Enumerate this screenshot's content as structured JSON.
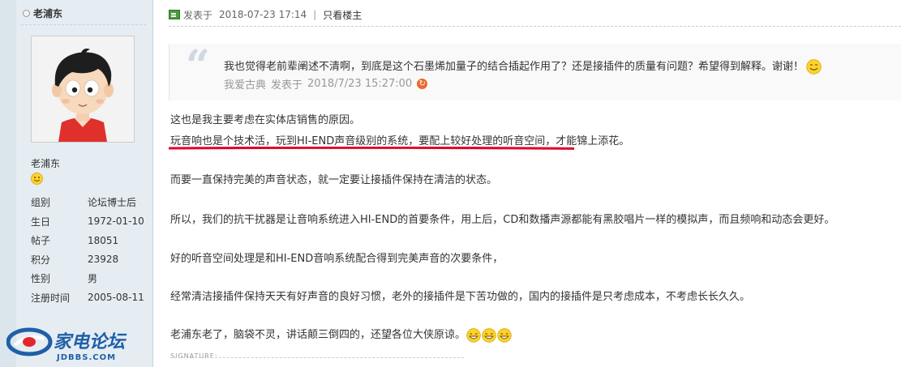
{
  "sidebar": {
    "author": "老浦东",
    "username": "老浦东",
    "info": [
      {
        "key": "组别",
        "value": "论坛博士后"
      },
      {
        "key": "生日",
        "value": "1972-01-10"
      },
      {
        "key": "帖子",
        "value": "18051"
      },
      {
        "key": "积分",
        "value": "23928"
      },
      {
        "key": "性别",
        "value": "男"
      },
      {
        "key": "注册时间",
        "value": "2005-08-11"
      }
    ],
    "logo_text": "家电论坛",
    "logo_url": "JDBBS.COM"
  },
  "post": {
    "posted_label": "发表于",
    "posted_time": "2018-07-23 17:14",
    "separator": "|",
    "author_only": "只看楼主",
    "quote": {
      "text": "我也觉得老前辈阐述不清啊，到底是这个石墨烯加量子的结合插起作用了？还是接插件的质量有问题？希望得到解释。谢谢！",
      "author": "我爱古典",
      "posted_label": "发表于",
      "time": "2018/7/23 15:27:00"
    },
    "lines": [
      "这也是我主要考虑在实体店销售的原因。",
      "玩音响也是个技术活，玩到HI-END声音级别的系统，要配上较好处理的听音空间，才能锦上添花。",
      "而要一直保持完美的声音状态，就一定要让接插件保持在清洁的状态。",
      "所以，我们的抗干扰器是让音响系统进入HI-END的首要条件，用上后，CD和数播声源都能有黑胶唱片一样的模拟声，而且频响和动态会更好。",
      "好的听音空间处理是和HI-END音响系统配合得到完美声音的次要条件，",
      "经常清洁接插件保持天天有好声音的良好习惯，老外的接插件是下苦功做的，国内的接插件是只考虑成本，不考虑长长久久。",
      "老浦东老了，脑袋不灵，讲话颠三倒四的，还望各位大侠原谅。"
    ],
    "signature_label": "SIGNATURE:"
  },
  "colors": {
    "sidebar_bg": "#e5edf2",
    "underline": "#e0002a",
    "logo_blue": "#1f5fa8",
    "logo_red": "#e3262e"
  }
}
